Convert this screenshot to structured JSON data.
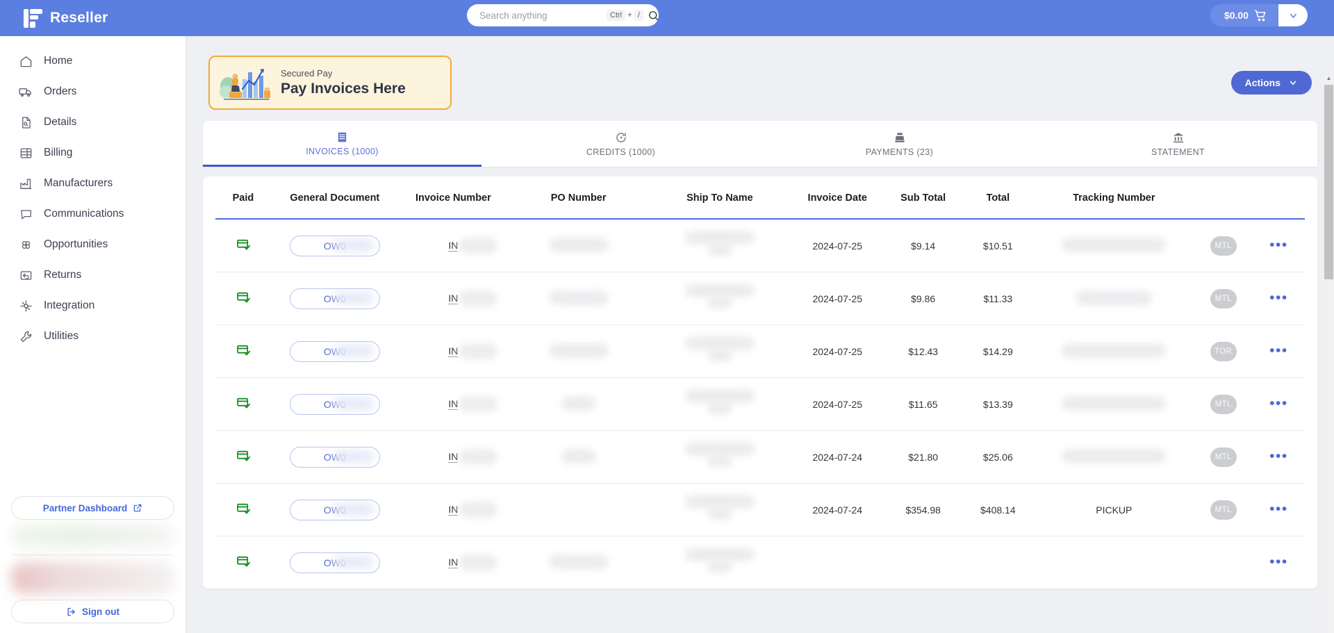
{
  "header": {
    "brand": "Reseller",
    "brand_logo_icon": "reseller-logo-icon",
    "search": {
      "placeholder": "Search anything",
      "value": "",
      "shortcut_key": "Ctrl",
      "shortcut_plus": "+",
      "shortcut_slash": "/",
      "icon": "search-icon"
    },
    "cart": {
      "amount": "$0.00",
      "icon": "shopping-cart-icon",
      "caret_icon": "chevron-down-icon"
    },
    "accent_color": "#5b7fe0"
  },
  "sidebar": {
    "items": [
      {
        "label": "Home",
        "icon": "home-icon"
      },
      {
        "label": "Orders",
        "icon": "truck-icon"
      },
      {
        "label": "Details",
        "icon": "document-search-icon"
      },
      {
        "label": "Billing",
        "icon": "billing-list-icon"
      },
      {
        "label": "Manufacturers",
        "icon": "factory-icon"
      },
      {
        "label": "Communications",
        "icon": "chat-bubble-icon"
      },
      {
        "label": "Opportunities",
        "icon": "clover-icon"
      },
      {
        "label": "Returns",
        "icon": "return-arrow-icon"
      },
      {
        "label": "Integration",
        "icon": "integration-node-icon"
      },
      {
        "label": "Utilities",
        "icon": "wrench-icon"
      }
    ],
    "partner_dashboard": {
      "label": "Partner Dashboard",
      "icon": "external-link-icon"
    },
    "sign_out": {
      "label": "Sign out",
      "icon": "sign-out-icon"
    },
    "link_color": "#4466dd"
  },
  "promo": {
    "subtitle": "Secured Pay",
    "title": "Pay Invoices Here",
    "border_color": "#f2a93b",
    "background_color": "#fdf4dd",
    "illustration_icon": "finance-growth-illustration"
  },
  "toolbar": {
    "actions_label": "Actions",
    "actions_caret_icon": "chevron-down-icon",
    "actions_color": "#4f68d4"
  },
  "tabs": [
    {
      "label": "INVOICES (1000)",
      "icon": "invoice-list-icon",
      "active": true
    },
    {
      "label": "CREDITS (1000)",
      "icon": "credit-refresh-icon",
      "active": false
    },
    {
      "label": "PAYMENTS (23)",
      "icon": "cash-register-icon",
      "active": false
    },
    {
      "label": "STATEMENT",
      "icon": "bank-icon",
      "active": false
    }
  ],
  "table": {
    "columns": [
      "Paid",
      "General Document",
      "Invoice Number",
      "PO Number",
      "Ship To Name",
      "Invoice Date",
      "Sub Total",
      "Total",
      "Tracking Number",
      "",
      ""
    ],
    "rows": [
      {
        "paid_icon": "card-paid-icon",
        "general_document": "OW0",
        "invoice_number": "IN",
        "po_number": "",
        "ship_to_name": "",
        "invoice_date": "2024-07-25",
        "sub_total": "$9.14",
        "total": "$10.51",
        "tracking_number": "",
        "badge": "MTL",
        "menu_icon": "more-options-icon"
      },
      {
        "paid_icon": "card-paid-icon",
        "general_document": "OW0",
        "invoice_number": "IN",
        "po_number": "",
        "ship_to_name": "",
        "invoice_date": "2024-07-25",
        "sub_total": "$9.86",
        "total": "$11.33",
        "tracking_number": "",
        "badge": "MTL",
        "menu_icon": "more-options-icon"
      },
      {
        "paid_icon": "card-paid-icon",
        "general_document": "OW0",
        "invoice_number": "IN",
        "po_number": "",
        "ship_to_name": "",
        "invoice_date": "2024-07-25",
        "sub_total": "$12.43",
        "total": "$14.29",
        "tracking_number": "",
        "badge": "TOR",
        "menu_icon": "more-options-icon"
      },
      {
        "paid_icon": "card-paid-icon",
        "general_document": "OW0",
        "invoice_number": "IN",
        "po_number": "",
        "ship_to_name": "",
        "invoice_date": "2024-07-25",
        "sub_total": "$11.65",
        "total": "$13.39",
        "tracking_number": "",
        "badge": "MTL",
        "menu_icon": "more-options-icon"
      },
      {
        "paid_icon": "card-paid-icon",
        "general_document": "OW0",
        "invoice_number": "IN",
        "po_number": "",
        "ship_to_name": "",
        "invoice_date": "2024-07-24",
        "sub_total": "$21.80",
        "total": "$25.06",
        "tracking_number": "",
        "badge": "MTL",
        "menu_icon": "more-options-icon"
      },
      {
        "paid_icon": "card-paid-icon",
        "general_document": "OW0",
        "invoice_number": "IN",
        "po_number": "",
        "ship_to_name": "",
        "invoice_date": "2024-07-24",
        "sub_total": "$354.98",
        "total": "$408.14",
        "tracking_number": "PICKUP",
        "badge": "MTL",
        "menu_icon": "more-options-icon"
      },
      {
        "paid_icon": "card-paid-icon",
        "general_document": "OW0",
        "invoice_number": "IN",
        "po_number": "",
        "ship_to_name": "",
        "invoice_date": "",
        "sub_total": "",
        "total": "",
        "tracking_number": "",
        "badge": "",
        "menu_icon": "more-options-icon"
      }
    ]
  }
}
